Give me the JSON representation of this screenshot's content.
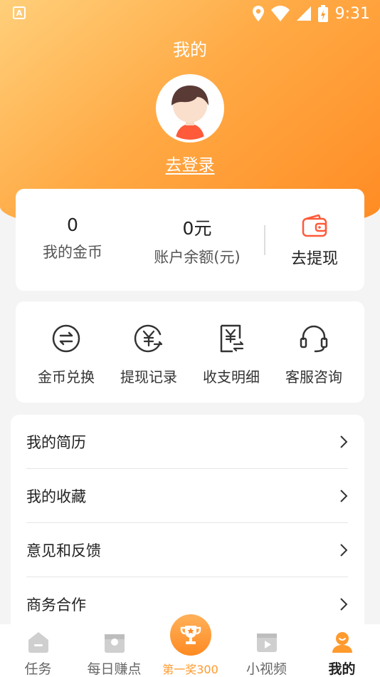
{
  "status_bar": {
    "time": "9:31",
    "left_icon_text": "A"
  },
  "header": {
    "title": "我的",
    "login_text": "去登录"
  },
  "stats": {
    "coins_value": "0",
    "coins_label": "我的金币",
    "balance_value": "0元",
    "balance_label": "账户余额(元)",
    "withdraw_label": "去提现"
  },
  "functions": [
    {
      "label": "金币兑换",
      "icon": "exchange-icon"
    },
    {
      "label": "提现记录",
      "icon": "yuan-record-icon"
    },
    {
      "label": "收支明细",
      "icon": "bill-details-icon"
    },
    {
      "label": "客服咨询",
      "icon": "headset-icon"
    }
  ],
  "menu": [
    {
      "label": "我的简历"
    },
    {
      "label": "我的收藏"
    },
    {
      "label": "意见和反馈"
    },
    {
      "label": "商务合作"
    }
  ],
  "bottom_nav": [
    {
      "label": "任务",
      "icon": "home-icon"
    },
    {
      "label": "每日赚点",
      "icon": "coin-box-icon"
    },
    {
      "label": "第一奖300",
      "icon": "trophy-icon"
    },
    {
      "label": "小视频",
      "icon": "video-icon"
    },
    {
      "label": "我的",
      "icon": "user-icon"
    }
  ],
  "colors": {
    "accent": "#ff9a2e",
    "header_start": "#ffcf7a",
    "header_end": "#ff8a22"
  }
}
